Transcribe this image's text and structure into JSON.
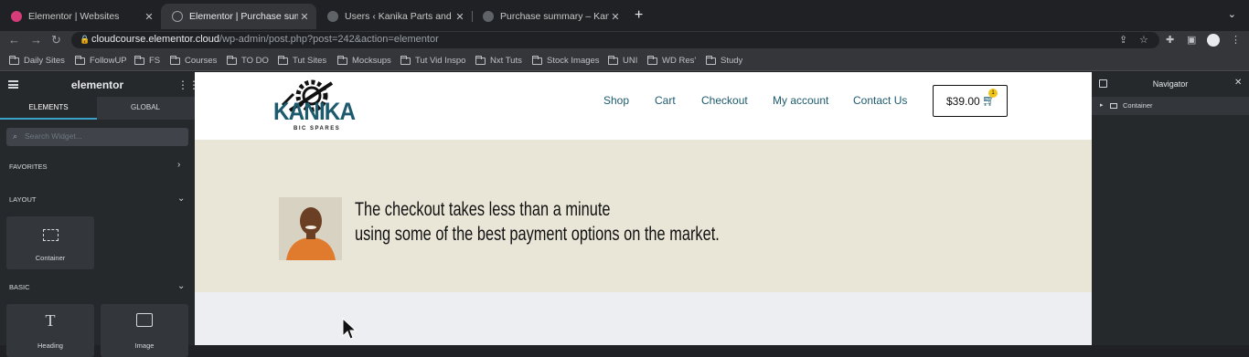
{
  "browser": {
    "tabs": [
      {
        "title": "Elementor | Websites",
        "favicon_color": "#d63b7a"
      },
      {
        "title": "Elementor | Purchase summary",
        "favicon_color": "#9aa0a6"
      },
      {
        "title": "Users ‹ Kanika Parts and Spares",
        "favicon_color": "#9aa0a6"
      },
      {
        "title": "Purchase summary – Kanika Parts",
        "favicon_color": "#9aa0a6"
      }
    ],
    "url_host": "cloudcourse.elementor.cloud",
    "url_path": "/wp-admin/post.php?post=242&action=elementor",
    "bookmarks": [
      "Daily Sites",
      "FollowUP",
      "FS",
      "Courses",
      "TO DO",
      "Tut Sites",
      "Mocksups",
      "Tut Vid Inspo",
      "Nxt Tuts",
      "Stock Images",
      "UNI",
      "WD Res'",
      "Study"
    ]
  },
  "panel": {
    "brand": "elementor",
    "tabs": [
      "ELEMENTS",
      "GLOBAL"
    ],
    "search_placeholder": "Search Widget...",
    "sections": {
      "favorites": "FAVORITES",
      "layout": "LAYOUT",
      "basic": "BASIC"
    },
    "widgets": {
      "container": "Container",
      "heading": "Heading",
      "image": "Image"
    }
  },
  "site": {
    "logo_text": "KANIKA",
    "logo_sub": "BIC SPARES",
    "menu": [
      "Shop",
      "Cart",
      "Checkout",
      "My account",
      "Contact Us"
    ],
    "cart_price": "$39.00",
    "cart_count": "1",
    "hero_line1": "The checkout takes less than a minute",
    "hero_line2": "using some of the best payment options on the market."
  },
  "navigator": {
    "title": "Navigator",
    "items": [
      "Container"
    ]
  },
  "colors": {
    "accent": "#1d5a6e",
    "hero_bg": "#e9e6d8",
    "panel_bg": "#26292c",
    "badge": "#f0c419"
  }
}
